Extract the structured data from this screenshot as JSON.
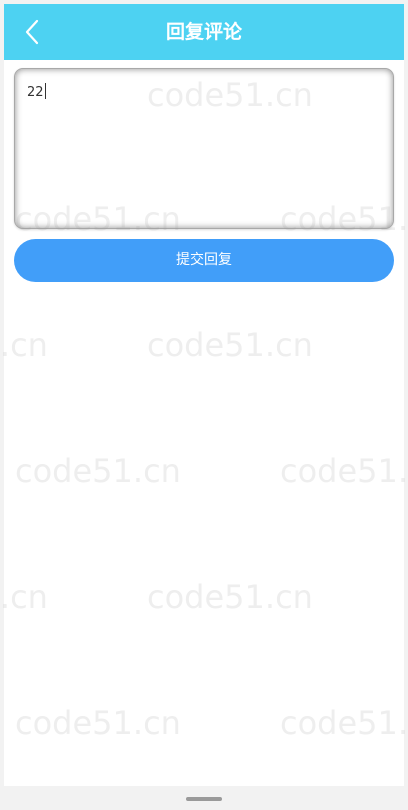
{
  "header": {
    "title": "回复评论",
    "back_icon": "chevron-left-icon"
  },
  "reply": {
    "value": "22"
  },
  "submit": {
    "label": "提交回复"
  },
  "watermark": {
    "text": "code51.cn"
  },
  "colors": {
    "header_bg": "#4dd2f2",
    "button_bg": "#419ef9",
    "page_bg": "#ffffff"
  }
}
